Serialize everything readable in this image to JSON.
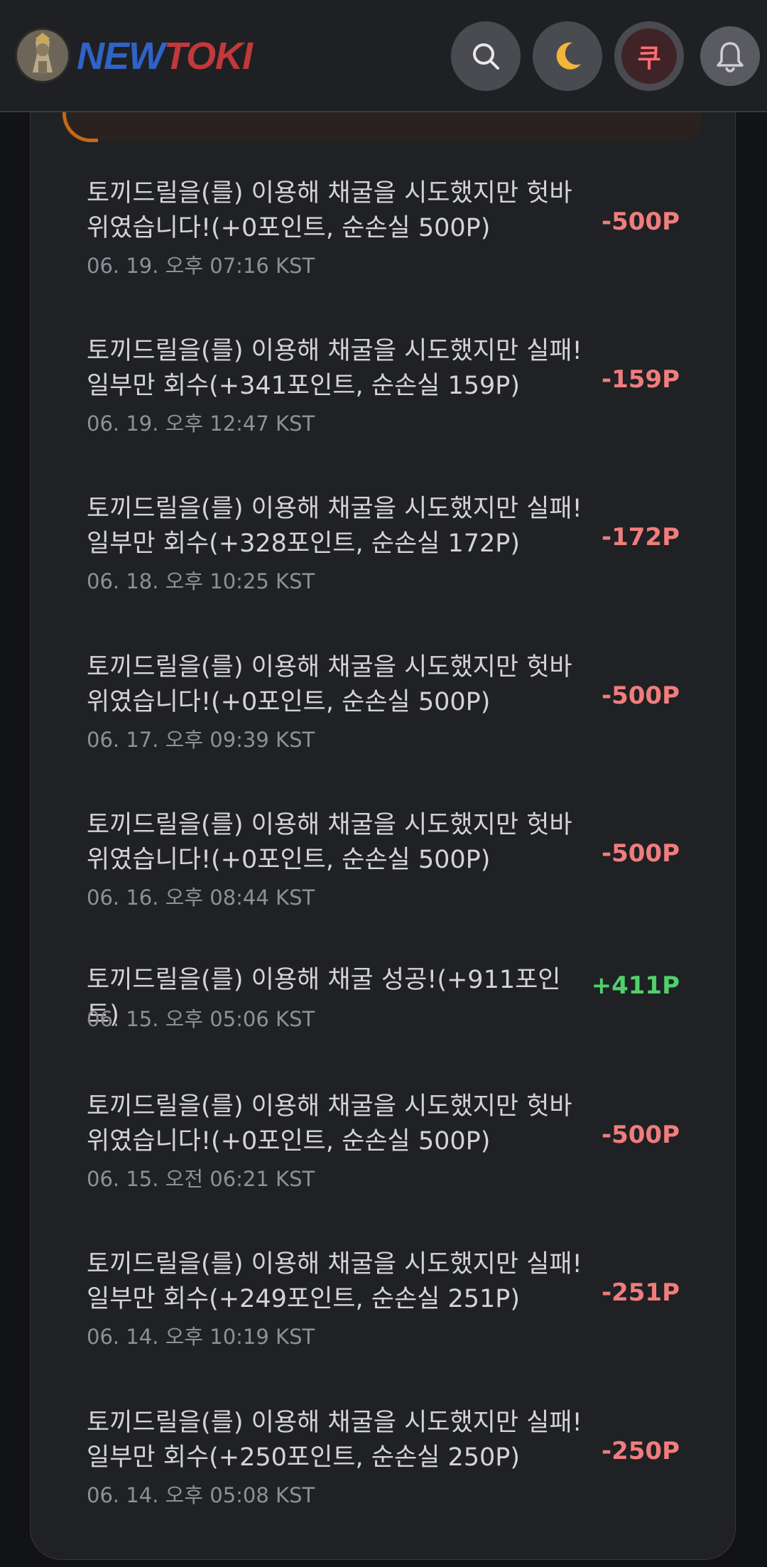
{
  "header": {
    "logo_part1": "NEW",
    "logo_part2": "TOKI",
    "quest_label": "쿠",
    "icons": [
      "search-icon",
      "moon-icon",
      "quest-icon",
      "bell-icon"
    ],
    "colors": {
      "logo_new": "#2f63c6",
      "logo_toki": "#c2383b",
      "negative": "#f07d7d",
      "positive": "#4fd06b"
    }
  },
  "entries": [
    {
      "desc": "토끼드릴을(를) 이용해 채굴을 시도했지만 헛바위였습니다!(+0포인트, 순손실 500P)",
      "time": "06. 19. 오후 07:16 KST",
      "amount": "-500P",
      "sign": "neg"
    },
    {
      "desc": "토끼드릴을(를) 이용해 채굴을 시도했지만 실패! 일부만 회수(+341포인트, 순손실 159P)",
      "time": "06. 19. 오후 12:47 KST",
      "amount": "-159P",
      "sign": "neg"
    },
    {
      "desc": "토끼드릴을(를) 이용해 채굴을 시도했지만 실패! 일부만 회수(+328포인트, 순손실 172P)",
      "time": "06. 18. 오후 10:25 KST",
      "amount": "-172P",
      "sign": "neg"
    },
    {
      "desc": "토끼드릴을(를) 이용해 채굴을 시도했지만 헛바위였습니다!(+0포인트, 순손실 500P)",
      "time": "06. 17. 오후 09:39 KST",
      "amount": "-500P",
      "sign": "neg"
    },
    {
      "desc": "토끼드릴을(를) 이용해 채굴을 시도했지만 헛바위였습니다!(+0포인트, 순손실 500P)",
      "time": "06. 16. 오후 08:44 KST",
      "amount": "-500P",
      "sign": "neg"
    },
    {
      "desc": "토끼드릴을(를) 이용해 채굴 성공!(+911포인트)",
      "time": "06. 15. 오후 05:06 KST",
      "amount": "+411P",
      "sign": "pos"
    },
    {
      "desc": "토끼드릴을(를) 이용해 채굴을 시도했지만 헛바위였습니다!(+0포인트, 순손실 500P)",
      "time": "06. 15. 오전 06:21 KST",
      "amount": "-500P",
      "sign": "neg"
    },
    {
      "desc": "토끼드릴을(를) 이용해 채굴을 시도했지만 실패! 일부만 회수(+249포인트, 순손실 251P)",
      "time": "06. 14. 오후 10:19 KST",
      "amount": "-251P",
      "sign": "neg"
    },
    {
      "desc": "토끼드릴을(를) 이용해 채굴을 시도했지만 실패! 일부만 회수(+250포인트, 순손실 250P)",
      "time": "06. 14. 오후 05:08 KST",
      "amount": "-250P",
      "sign": "neg"
    }
  ]
}
